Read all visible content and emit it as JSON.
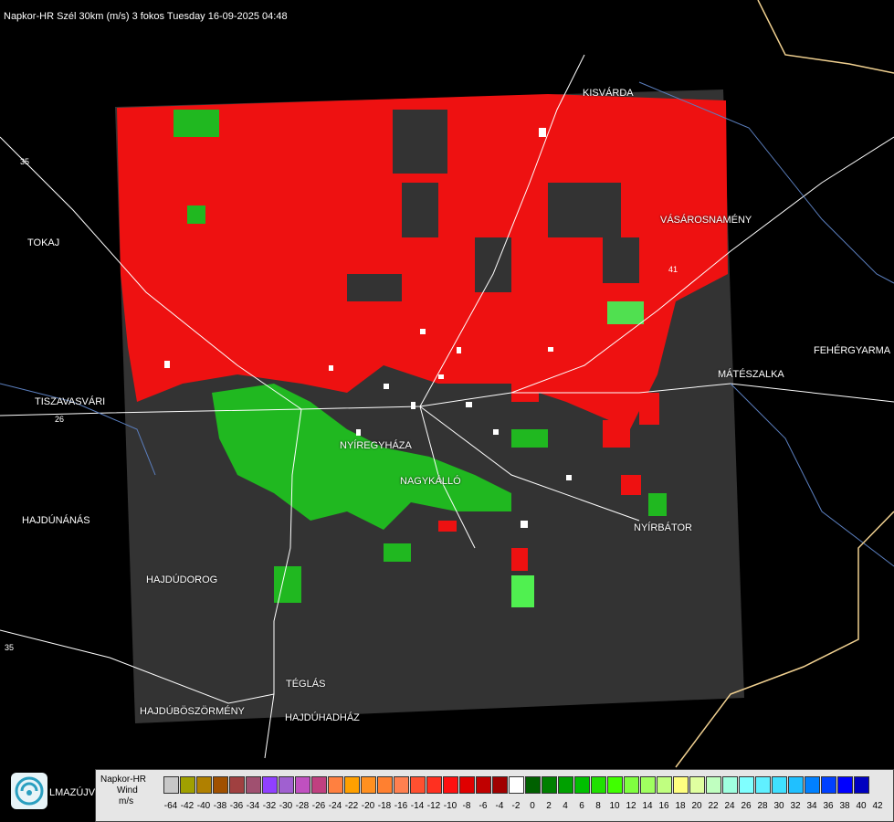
{
  "title": "Napkor-HR Szél 30km (m/s) 3 fokos Tuesday 16-09-2025 04:48",
  "places": [
    {
      "id": "kisvarda",
      "name": "KISVÁRDA"
    },
    {
      "id": "tokaj",
      "name": "TOKAJ"
    },
    {
      "id": "vasarosnameny",
      "name": "VÁSÁROSNAMÉNY"
    },
    {
      "id": "fehergyarmat",
      "name": "FEHÉRGYARMA"
    },
    {
      "id": "mateszalka",
      "name": "MÁTÉSZALKA"
    },
    {
      "id": "tiszavasvari",
      "name": "TISZAVASVÁRI"
    },
    {
      "id": "nyiregyhaza",
      "name": "NYÍREGYHÁZA"
    },
    {
      "id": "nagykallo",
      "name": "NAGYKÁLLÓ"
    },
    {
      "id": "hajdunanas",
      "name": "HAJDÚNÁNÁS"
    },
    {
      "id": "nyirbator",
      "name": "NYÍRBÁTOR"
    },
    {
      "id": "hajdudorog",
      "name": "HAJDÚDOROG"
    },
    {
      "id": "teglas",
      "name": "TÉGLÁS"
    },
    {
      "id": "hajduboszormeny",
      "name": "HAJDÚBÖSZÖRMÉNY"
    },
    {
      "id": "hajduhadhaz",
      "name": "HAJDÚHADHÁZ"
    },
    {
      "id": "balmazujvaros",
      "name": "LMAZÚJVÁR"
    }
  ],
  "road_numbers": [
    "35",
    "26",
    "41",
    "35"
  ],
  "legend": {
    "line1": "Napkor-HR",
    "line2": "Wind",
    "line3": "m/s",
    "ticks": [
      "-64",
      "-42",
      "-40",
      "-38",
      "-36",
      "-34",
      "-32",
      "-30",
      "-28",
      "-26",
      "-24",
      "-22",
      "-20",
      "-18",
      "-16",
      "-14",
      "-12",
      "-10",
      "-8",
      "-6",
      "-4",
      "-2",
      "0",
      "2",
      "4",
      "6",
      "8",
      "10",
      "12",
      "14",
      "16",
      "18",
      "20",
      "22",
      "24",
      "26",
      "28",
      "30",
      "32",
      "34",
      "36",
      "38",
      "40",
      "42"
    ],
    "colors": [
      "#c8c8c8",
      "#a0a000",
      "#b08000",
      "#a05000",
      "#a04040",
      "#a05070",
      "#9040ff",
      "#a060d0",
      "#c050c0",
      "#c04080",
      "#ff8040",
      "#ffa000",
      "#ff9020",
      "#ff8030",
      "#ff8050",
      "#ff5030",
      "#ff3020",
      "#ff1010",
      "#e00000",
      "#c00000",
      "#a00000",
      "#ffffff",
      "#006000",
      "#008000",
      "#00a000",
      "#00c000",
      "#20e000",
      "#40ff00",
      "#80ff40",
      "#a0ff60",
      "#c0ff80",
      "#ffff80",
      "#e0ffa0",
      "#c0ffc0",
      "#a0ffe0",
      "#80ffff",
      "#60f0ff",
      "#40e0ff",
      "#20c0ff",
      "#0080ff",
      "#0040ff",
      "#0000ff",
      "#0000c0"
    ]
  },
  "colors": {
    "background": "#000000",
    "radar_area": "#333333",
    "approaching": "#ff1010",
    "receding": "#20c000"
  }
}
